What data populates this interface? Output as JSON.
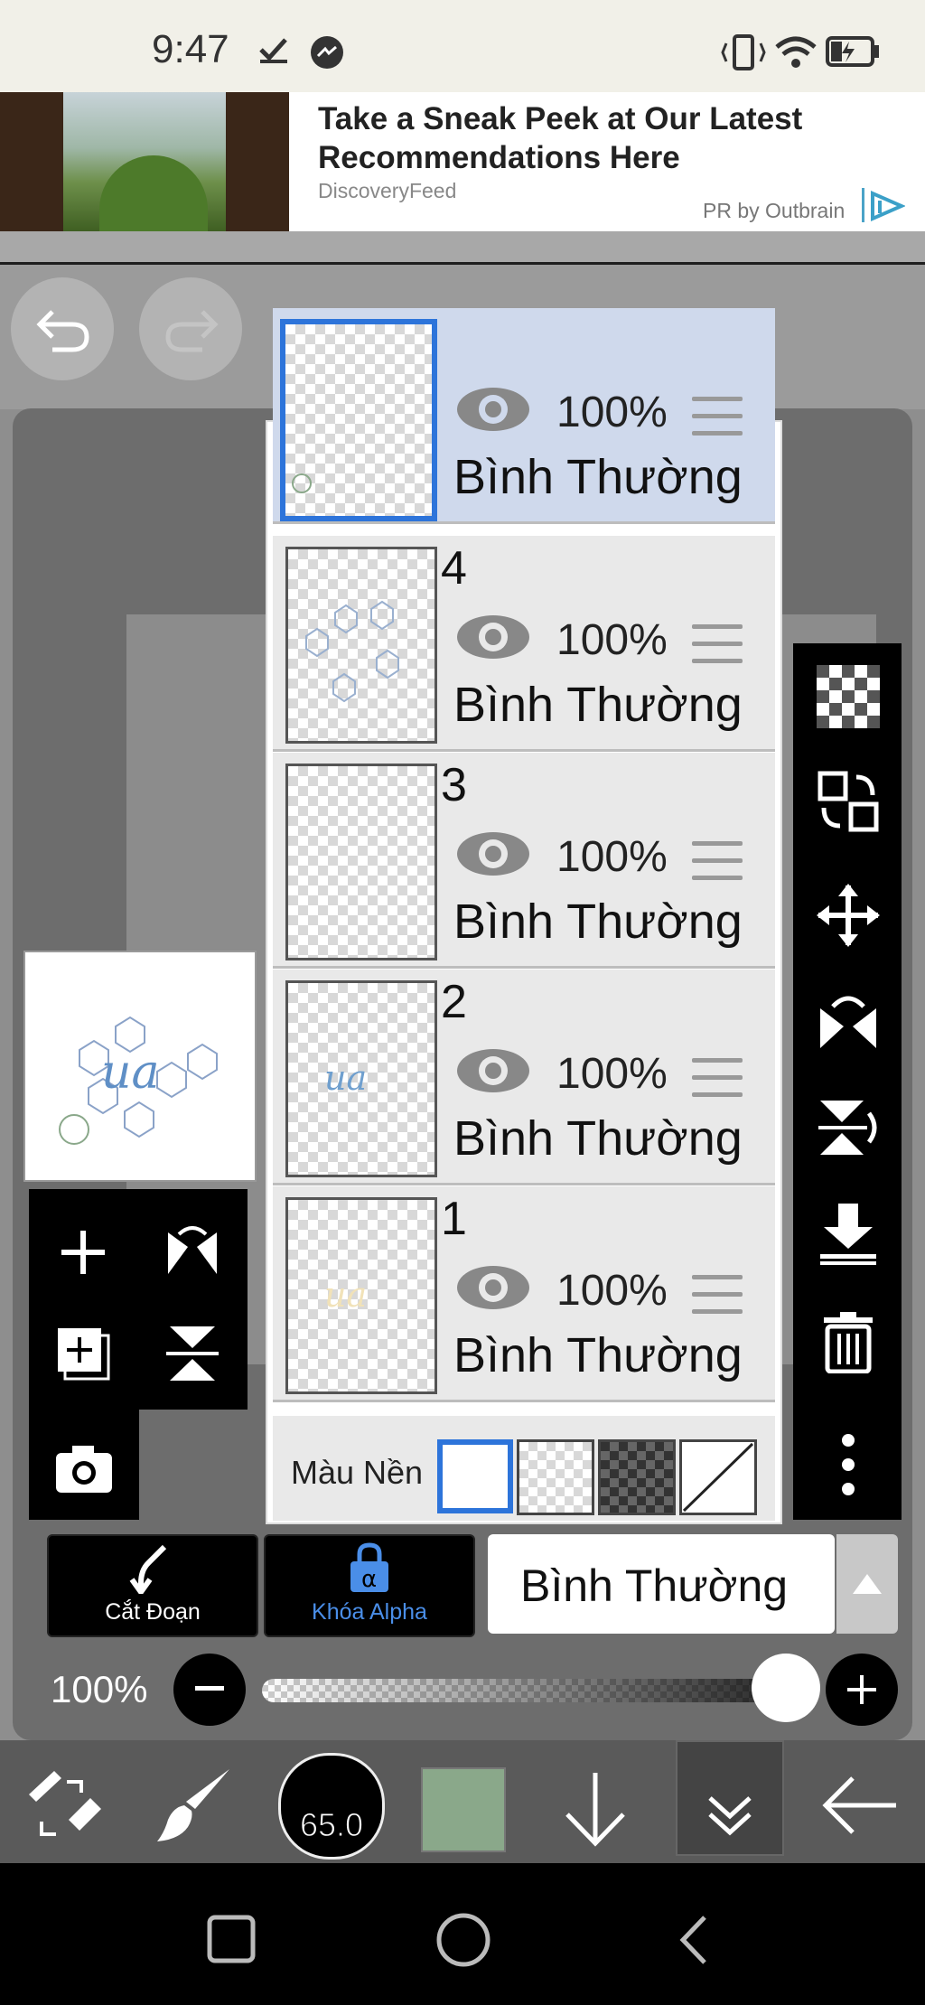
{
  "status_bar": {
    "time": "9:47"
  },
  "ad": {
    "title": "Take a Sneak Peek at Our Latest Recommendations Here",
    "source": "DiscoveryFeed",
    "attribution": "PR by Outbrain"
  },
  "layers": [
    {
      "number": "",
      "opacity": "100%",
      "blend": "Bình Thường",
      "selected": true
    },
    {
      "number": "4",
      "opacity": "100%",
      "blend": "Bình Thường",
      "selected": false
    },
    {
      "number": "3",
      "opacity": "100%",
      "blend": "Bình Thường",
      "selected": false
    },
    {
      "number": "2",
      "opacity": "100%",
      "blend": "Bình Thường",
      "selected": false
    },
    {
      "number": "1",
      "opacity": "100%",
      "blend": "Bình Thường",
      "selected": false
    }
  ],
  "background": {
    "label": "Màu Nền"
  },
  "controls": {
    "clip_label": "Cắt Đoạn",
    "alpha_lock_label": "Khóa Alpha",
    "blend_mode": "Bình Thường",
    "opacity": "100%"
  },
  "toolbar": {
    "brush_size": "65.0",
    "color": "#8aa88a"
  },
  "colors": {
    "accent": "#2d74da",
    "alpha_lock": "#4a8ee8"
  }
}
